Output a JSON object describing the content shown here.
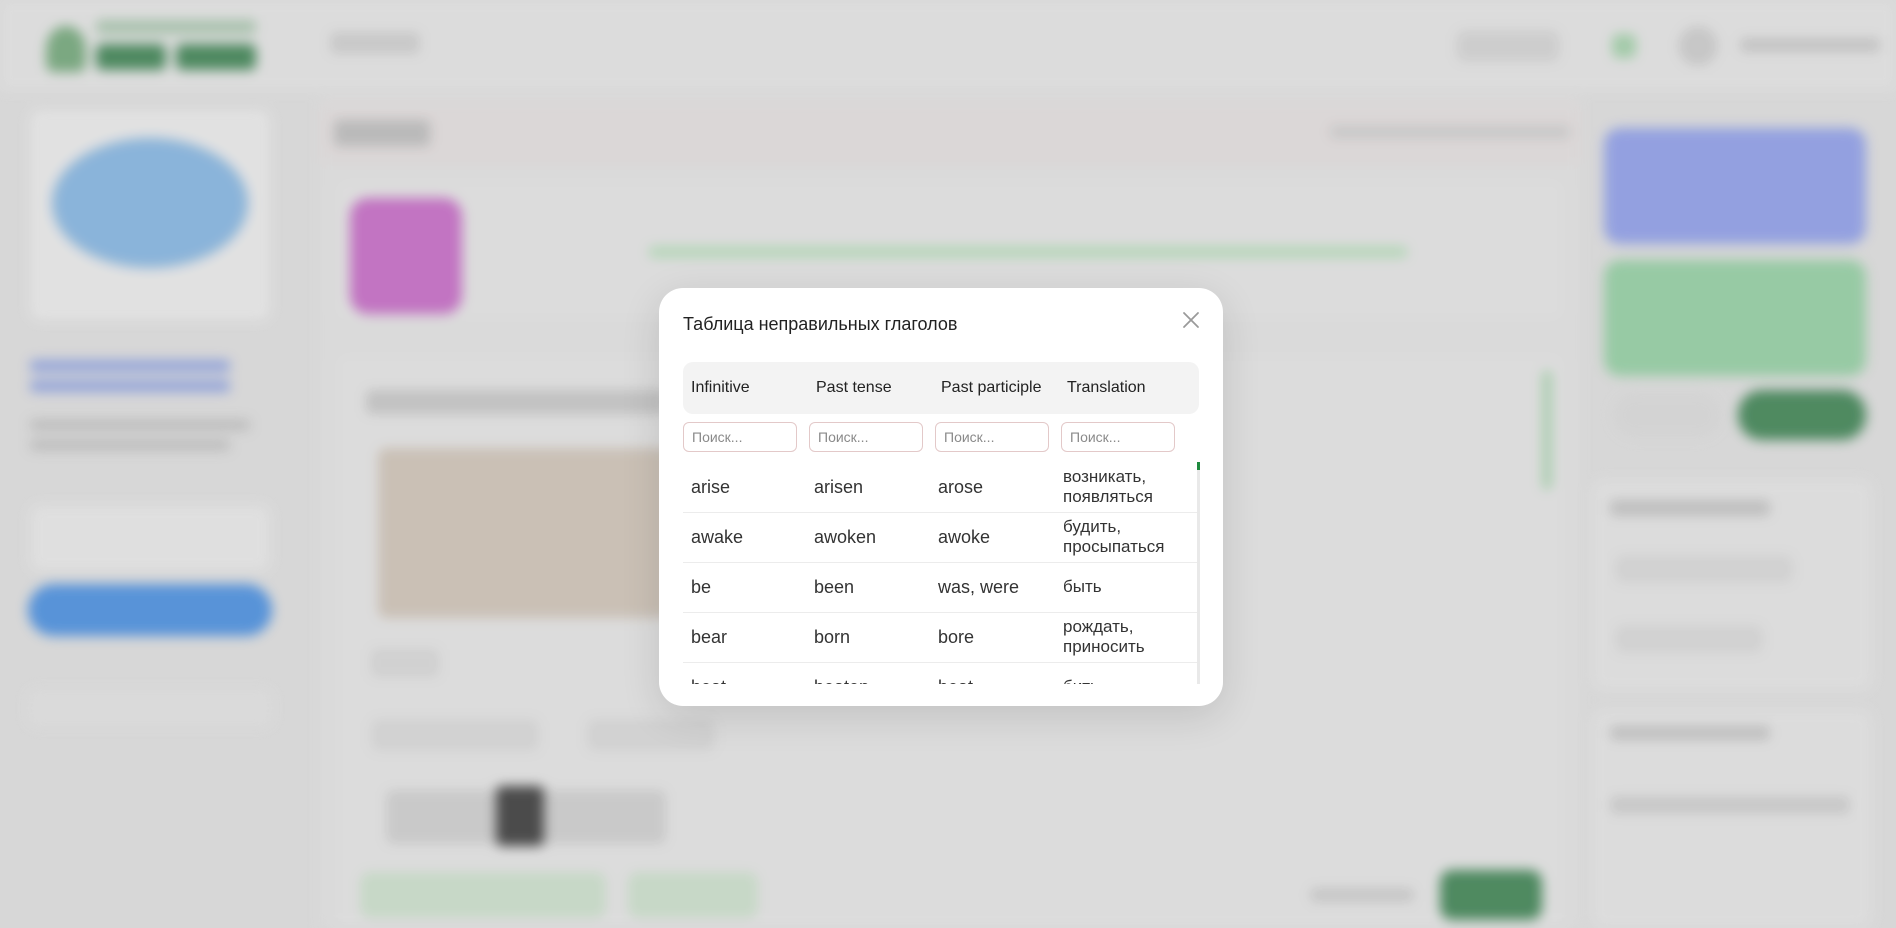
{
  "modal": {
    "title": "Таблица неправильных глаголов",
    "columns": [
      "Infinitive",
      "Past tense",
      "Past participle",
      "Translation"
    ],
    "search_placeholder": "Поиск...",
    "rows": [
      {
        "infinitive": "arise",
        "past_tense": "arisen",
        "past_participle": "arose",
        "translation": "возникать, появляться"
      },
      {
        "infinitive": "awake",
        "past_tense": "awoken",
        "past_participle": "awoke",
        "translation": "будить, просыпаться"
      },
      {
        "infinitive": "be",
        "past_tense": "been",
        "past_participle": "was, were",
        "translation": "быть"
      },
      {
        "infinitive": "bear",
        "past_tense": "born",
        "past_participle": "bore",
        "translation": "рождать, приносить"
      },
      {
        "infinitive": "beat",
        "past_tense": "beaten",
        "past_participle": "beat",
        "translation": "бить"
      }
    ]
  },
  "icons": {
    "close": "close-icon"
  },
  "colors": {
    "scroll_thumb": "#1f8a3f",
    "input_border": "#e3c9c9"
  }
}
